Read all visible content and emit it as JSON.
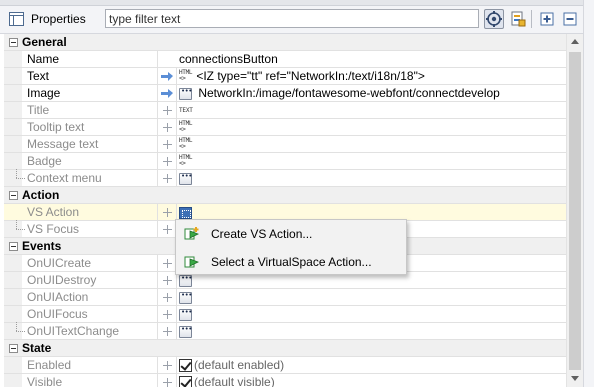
{
  "header": {
    "title": "Properties",
    "filter_placeholder": "type filter text",
    "icons": [
      "properties-view-icon",
      "show-advanced-icon",
      "show-events-icon",
      "expand-all-icon",
      "collapse-all-icon"
    ]
  },
  "categories": {
    "general": "General",
    "action": "Action",
    "events": "Events",
    "state": "State"
  },
  "rows": {
    "name": {
      "label": "Name",
      "value": "connectionsButton"
    },
    "text": {
      "label": "Text",
      "value": "<IZ type=\"tt\" ref=\"NetworkIn:/text/i18n/18\">"
    },
    "image": {
      "label": "Image",
      "value": "NetworkIn:/image/fontawesome-webfont/connectdevelop"
    },
    "title": {
      "label": "Title"
    },
    "tooltip": {
      "label": "Tooltip text"
    },
    "message": {
      "label": "Message text"
    },
    "badge": {
      "label": "Badge"
    },
    "context_menu": {
      "label": "Context menu"
    },
    "vs_action": {
      "label": "VS Action"
    },
    "vs_focus": {
      "label": "VS Focus"
    },
    "on_ui_create": {
      "label": "OnUICreate"
    },
    "on_ui_destroy": {
      "label": "OnUIDestroy"
    },
    "on_ui_action": {
      "label": "OnUIAction"
    },
    "on_ui_focus": {
      "label": "OnUIFocus"
    },
    "on_ui_text_change": {
      "label": "OnUITextChange"
    },
    "enabled": {
      "label": "Enabled",
      "value": "(default enabled)",
      "checked": true
    },
    "visible": {
      "label": "Visible",
      "value": "(default visible)",
      "checked": true
    }
  },
  "value_icons": {
    "html_top": "HTML",
    "html_bottom": "<>",
    "text": "TEXT"
  },
  "popup": {
    "items": [
      {
        "label": "Create VS Action..."
      },
      {
        "label": "Select a VirtualSpace Action..."
      }
    ]
  },
  "colors": {
    "selected_row": "#fffbdf",
    "category_bg": "#f0f0f0",
    "disabled_text": "#8c8c8c",
    "vs_icon": "#3d6fb5"
  }
}
